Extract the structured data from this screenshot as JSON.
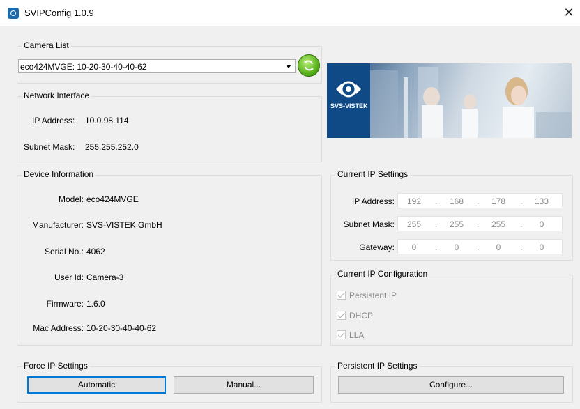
{
  "window": {
    "title": "SVIPConfig 1.0.9",
    "close_glyph": "✕"
  },
  "camera_list": {
    "legend": "Camera List",
    "selected": "eco424MVGE: 10-20-30-40-40-62"
  },
  "network_interface": {
    "legend": "Network Interface",
    "ip_label": "IP Address:",
    "ip_value": "10.0.98.114",
    "subnet_label": "Subnet Mask:",
    "subnet_value": "255.255.252.0"
  },
  "banner": {
    "brand": "SVS-VISTEK"
  },
  "device_info": {
    "legend": "Device Information",
    "rows": [
      {
        "label": "Model:",
        "value": "eco424MVGE"
      },
      {
        "label": "Manufacturer:",
        "value": "SVS-VISTEK GmbH"
      },
      {
        "label": "Serial No.:",
        "value": "4062"
      },
      {
        "label": "User Id:",
        "value": "Camera-3"
      },
      {
        "label": "Firmware:",
        "value": "1.6.0"
      },
      {
        "label": "Mac Address:",
        "value": "10-20-30-40-40-62"
      }
    ]
  },
  "current_ip_settings": {
    "legend": "Current IP Settings",
    "rows": [
      {
        "label": "IP Address:",
        "octets": [
          "192",
          "168",
          "178",
          "133"
        ]
      },
      {
        "label": "Subnet Mask:",
        "octets": [
          "255",
          "255",
          "255",
          "0"
        ]
      },
      {
        "label": "Gateway:",
        "octets": [
          "0",
          "0",
          "0",
          "0"
        ]
      }
    ],
    "separator": "."
  },
  "current_ip_config": {
    "legend": "Current IP Configuration",
    "options": [
      {
        "label": "Persistent IP",
        "checked": true
      },
      {
        "label": "DHCP",
        "checked": true
      },
      {
        "label": "LLA",
        "checked": true
      }
    ]
  },
  "force_ip": {
    "legend": "Force IP Settings",
    "automatic_label": "Automatic",
    "manual_label": "Manual..."
  },
  "persistent_ip": {
    "legend": "Persistent IP Settings",
    "configure_label": "Configure..."
  },
  "colors": {
    "accent": "#0078d7",
    "banner_blue": "#1a5c9a",
    "refresh_green": "#4aa80f"
  }
}
